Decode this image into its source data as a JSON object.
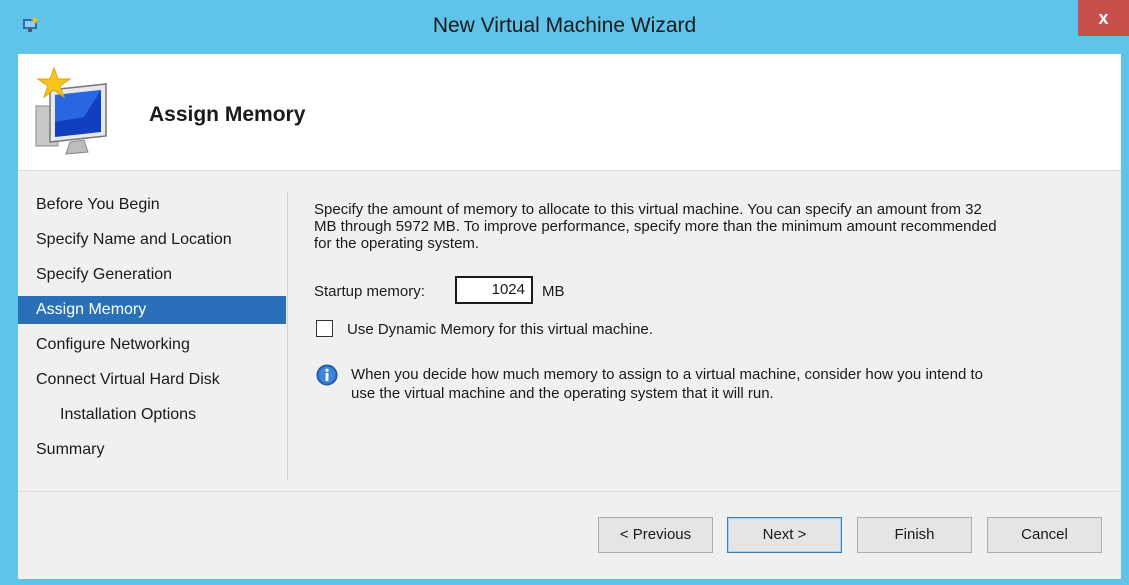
{
  "window": {
    "title": "New Virtual Machine Wizard",
    "close_label": "x"
  },
  "header": {
    "title": "Assign Memory",
    "icon": "monitor-star-icon"
  },
  "nav": {
    "items": [
      {
        "label": "Before You Begin",
        "selected": false,
        "indent": false
      },
      {
        "label": "Specify Name and Location",
        "selected": false,
        "indent": false
      },
      {
        "label": "Specify Generation",
        "selected": false,
        "indent": false
      },
      {
        "label": "Assign Memory",
        "selected": true,
        "indent": false
      },
      {
        "label": "Configure Networking",
        "selected": false,
        "indent": false
      },
      {
        "label": "Connect Virtual Hard Disk",
        "selected": false,
        "indent": false
      },
      {
        "label": "Installation Options",
        "selected": false,
        "indent": true
      },
      {
        "label": "Summary",
        "selected": false,
        "indent": false
      }
    ]
  },
  "content": {
    "description_lines": [
      "Specify the amount of memory to allocate to this virtual machine. You can specify an amount from 32",
      "MB through 5972 MB. To improve performance, specify more than the minimum amount recommended",
      "for the operating system."
    ],
    "startup_memory_label": "Startup memory:",
    "startup_memory_value": "1024",
    "startup_memory_unit": "MB",
    "dynamic_memory_label": "Use Dynamic Memory for this virtual machine.",
    "dynamic_memory_checked": false,
    "info_lines": [
      "When you decide how much memory to assign to a virtual machine, consider how you intend to",
      "use the virtual machine and the operating system that it will run."
    ],
    "info_icon": "info-icon"
  },
  "buttons": {
    "previous": "< Previous",
    "next": "Next >",
    "finish": "Finish",
    "cancel": "Cancel"
  },
  "colors": {
    "title_bar": "#5fc3ea",
    "selected_nav": "#2a70b8",
    "close_button": "#c7504a"
  }
}
